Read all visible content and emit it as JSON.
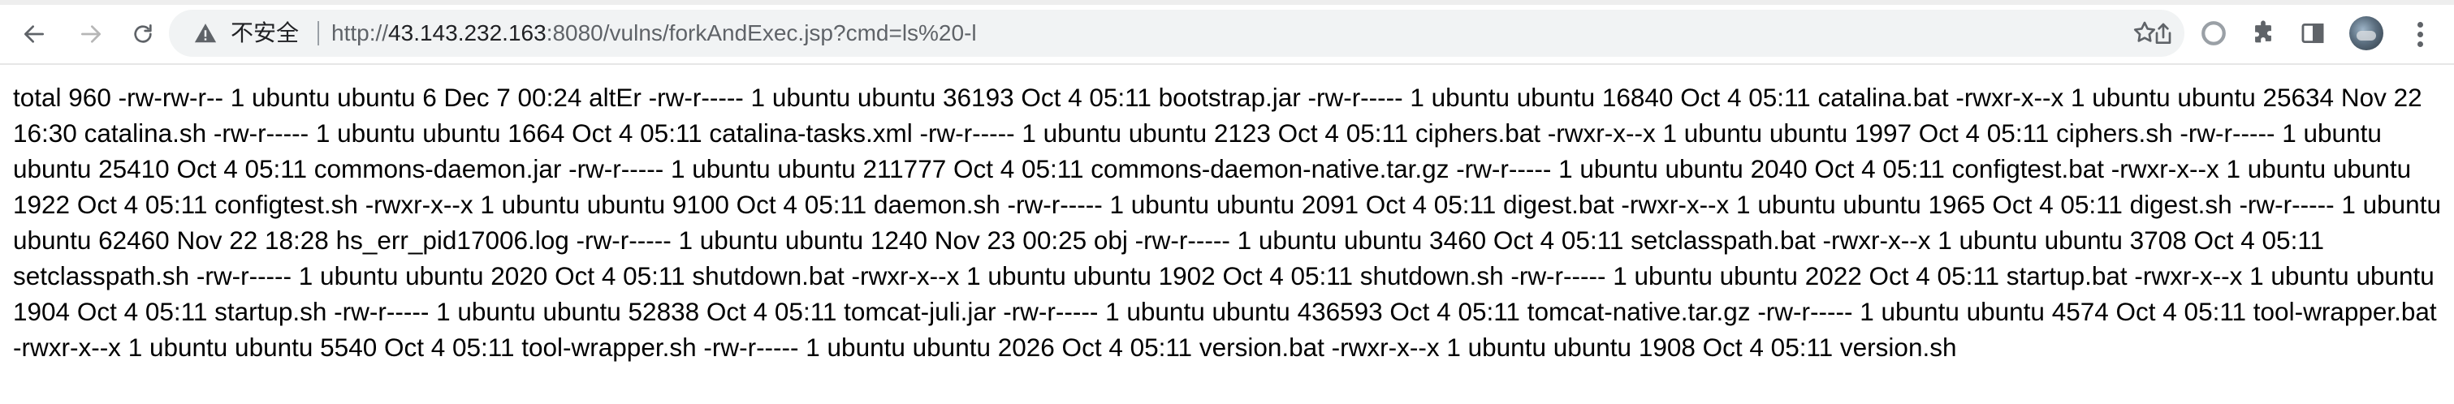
{
  "browser": {
    "security_label": "不安全",
    "url_prefix": "http://",
    "url_host": "43.143.232.163",
    "url_rest": ":8080/vulns/forkAndExec.jsp?cmd=ls%20-l",
    "icons": {
      "back": "back-arrow-icon",
      "forward": "forward-arrow-icon",
      "reload": "reload-icon",
      "warning": "warning-icon",
      "share": "share-icon",
      "bookmark": "star-icon",
      "extension_a": "circle-extension-icon",
      "extensions": "puzzle-icon",
      "side_panel": "side-panel-icon",
      "profile": "avatar",
      "menu": "kebab-menu-icon"
    },
    "colors": {
      "icon": "#5f6368",
      "omnibox_bg": "#f1f3f4",
      "text": "#202124"
    }
  },
  "page": {
    "output": "total 960 -rw-rw-r-- 1 ubuntu ubuntu 6 Dec 7 00:24 altEr -rw-r----- 1 ubuntu ubuntu 36193 Oct 4 05:11 bootstrap.jar -rw-r----- 1 ubuntu ubuntu 16840 Oct 4 05:11 catalina.bat -rwxr-x--x 1 ubuntu ubuntu 25634 Nov 22 16:30 catalina.sh -rw-r----- 1 ubuntu ubuntu 1664 Oct 4 05:11 catalina-tasks.xml -rw-r----- 1 ubuntu ubuntu 2123 Oct 4 05:11 ciphers.bat -rwxr-x--x 1 ubuntu ubuntu 1997 Oct 4 05:11 ciphers.sh -rw-r----- 1 ubuntu ubuntu 25410 Oct 4 05:11 commons-daemon.jar -rw-r----- 1 ubuntu ubuntu 211777 Oct 4 05:11 commons-daemon-native.tar.gz -rw-r----- 1 ubuntu ubuntu 2040 Oct 4 05:11 configtest.bat -rwxr-x--x 1 ubuntu ubuntu 1922 Oct 4 05:11 configtest.sh -rwxr-x--x 1 ubuntu ubuntu 9100 Oct 4 05:11 daemon.sh -rw-r----- 1 ubuntu ubuntu 2091 Oct 4 05:11 digest.bat -rwxr-x--x 1 ubuntu ubuntu 1965 Oct 4 05:11 digest.sh -rw-r----- 1 ubuntu ubuntu 62460 Nov 22 18:28 hs_err_pid17006.log -rw-r----- 1 ubuntu ubuntu 1240 Nov 23 00:25 obj -rw-r----- 1 ubuntu ubuntu 3460 Oct 4 05:11 setclasspath.bat -rwxr-x--x 1 ubuntu ubuntu 3708 Oct 4 05:11 setclasspath.sh -rw-r----- 1 ubuntu ubuntu 2020 Oct 4 05:11 shutdown.bat -rwxr-x--x 1 ubuntu ubuntu 1902 Oct 4 05:11 shutdown.sh -rw-r----- 1 ubuntu ubuntu 2022 Oct 4 05:11 startup.bat -rwxr-x--x 1 ubuntu ubuntu 1904 Oct 4 05:11 startup.sh -rw-r----- 1 ubuntu ubuntu 52838 Oct 4 05:11 tomcat-juli.jar -rw-r----- 1 ubuntu ubuntu 436593 Oct 4 05:11 tomcat-native.tar.gz -rw-r----- 1 ubuntu ubuntu 4574 Oct 4 05:11 tool-wrapper.bat -rwxr-x--x 1 ubuntu ubuntu 5540 Oct 4 05:11 tool-wrapper.sh -rw-r----- 1 ubuntu ubuntu 2026 Oct 4 05:11 version.bat -rwxr-x--x 1 ubuntu ubuntu 1908 Oct 4 05:11 version.sh"
  }
}
